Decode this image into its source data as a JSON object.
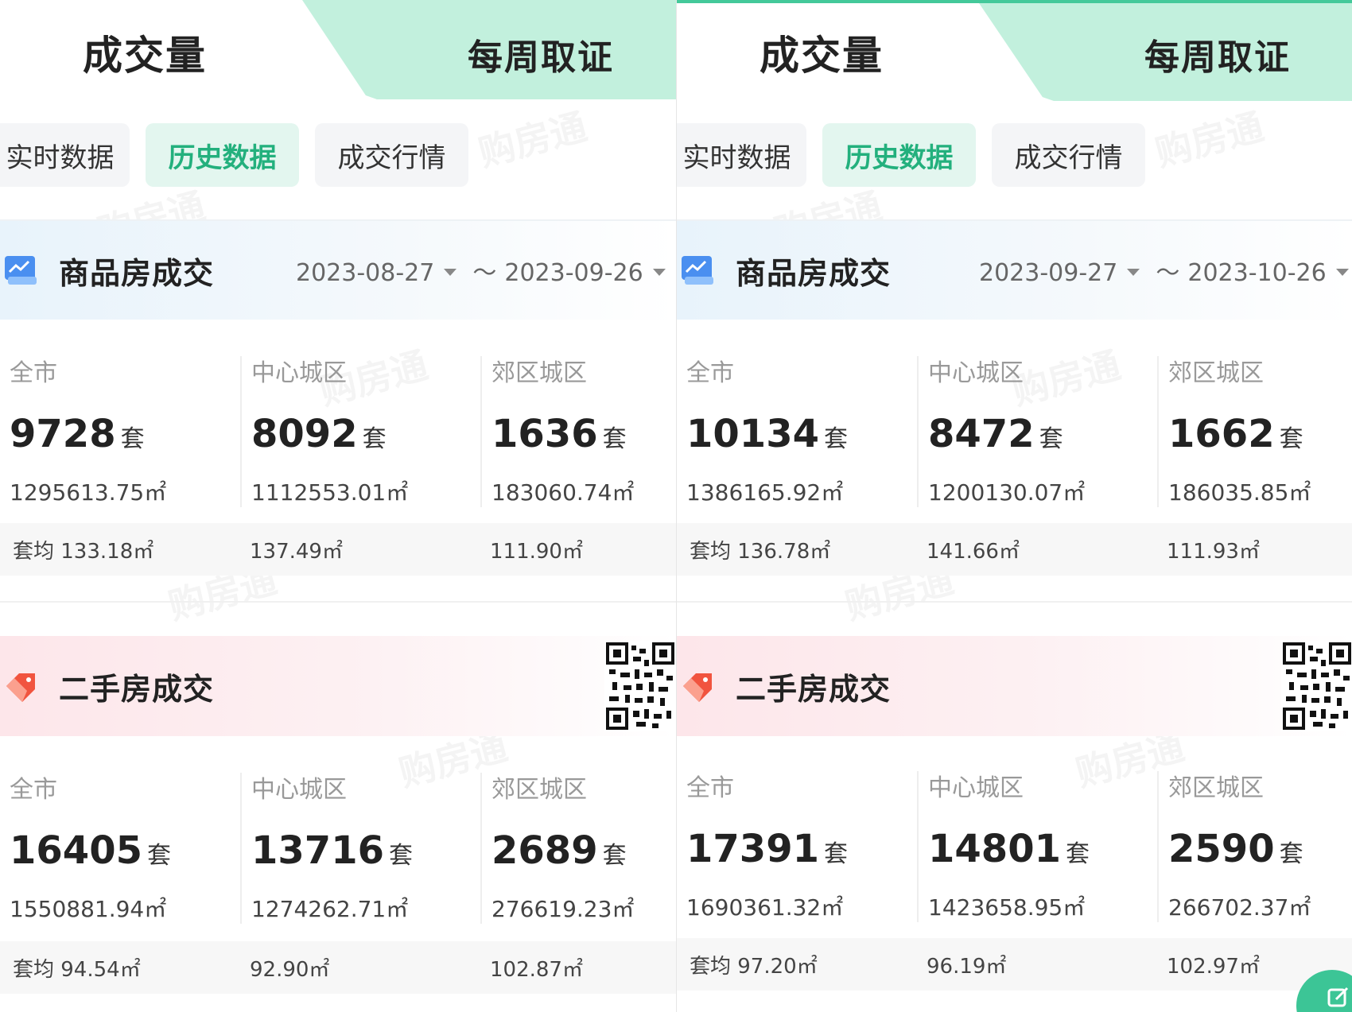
{
  "panels": [
    {
      "header": {
        "tab_main": "成交量",
        "tab_weekly": "每周取证"
      },
      "sub_tabs": [
        "实时数据",
        "历史数据",
        "成交行情"
      ],
      "watermark": "购房通",
      "new_house": {
        "title": "商品房成交",
        "date_start": "2023-08-27",
        "date_end": "2023-09-26",
        "separator": "～",
        "cols": [
          {
            "label": "全市",
            "count": "9728",
            "unit": "套",
            "area": "1295613.75㎡",
            "avg": "套均 133.18㎡"
          },
          {
            "label": "中心城区",
            "count": "8092",
            "unit": "套",
            "area": "1112553.01㎡",
            "avg": "137.49㎡"
          },
          {
            "label": "郊区城区",
            "count": "1636",
            "unit": "套",
            "area": "183060.74㎡",
            "avg": "111.90㎡"
          }
        ]
      },
      "second_house": {
        "title": "二手房成交",
        "cols": [
          {
            "label": "全市",
            "count": "16405",
            "unit": "套",
            "area": "1550881.94㎡",
            "avg": "套均 94.54㎡"
          },
          {
            "label": "中心城区",
            "count": "13716",
            "unit": "套",
            "area": "1274262.71㎡",
            "avg": "92.90㎡"
          },
          {
            "label": "郊区城区",
            "count": "2689",
            "unit": "套",
            "area": "276619.23㎡",
            "avg": "102.87㎡"
          }
        ]
      }
    },
    {
      "header": {
        "tab_main": "成交量",
        "tab_weekly": "每周取证"
      },
      "sub_tabs": [
        "实时数据",
        "历史数据",
        "成交行情"
      ],
      "watermark": "购房通",
      "new_house": {
        "title": "商品房成交",
        "date_start": "2023-09-27",
        "date_end": "2023-10-26",
        "separator": "～",
        "cols": [
          {
            "label": "全市",
            "count": "10134",
            "unit": "套",
            "area": "1386165.92㎡",
            "avg": "套均 136.78㎡"
          },
          {
            "label": "中心城区",
            "count": "8472",
            "unit": "套",
            "area": "1200130.07㎡",
            "avg": "141.66㎡"
          },
          {
            "label": "郊区城区",
            "count": "1662",
            "unit": "套",
            "area": "186035.85㎡",
            "avg": "111.93㎡"
          }
        ]
      },
      "second_house": {
        "title": "二手房成交",
        "cols": [
          {
            "label": "全市",
            "count": "17391",
            "unit": "套",
            "area": "1690361.32㎡",
            "avg": "套均 97.20㎡"
          },
          {
            "label": "中心城区",
            "count": "14801",
            "unit": "套",
            "area": "1423658.95㎡",
            "avg": "96.19㎡"
          },
          {
            "label": "郊区城区",
            "count": "2590",
            "unit": "套",
            "area": "266702.37㎡",
            "avg": "102.97㎡"
          }
        ]
      }
    }
  ],
  "colors": {
    "accent_green": "#23b07d",
    "tab_green_bg": "#c2f0dd",
    "second_pink": "#fde6ea",
    "new_blue": "#e8f3fb"
  },
  "icons": {
    "new_house": "chart-card-icon",
    "second_house": "price-tag-icon",
    "qr": "qr-code-icon",
    "float": "edit-icon"
  }
}
